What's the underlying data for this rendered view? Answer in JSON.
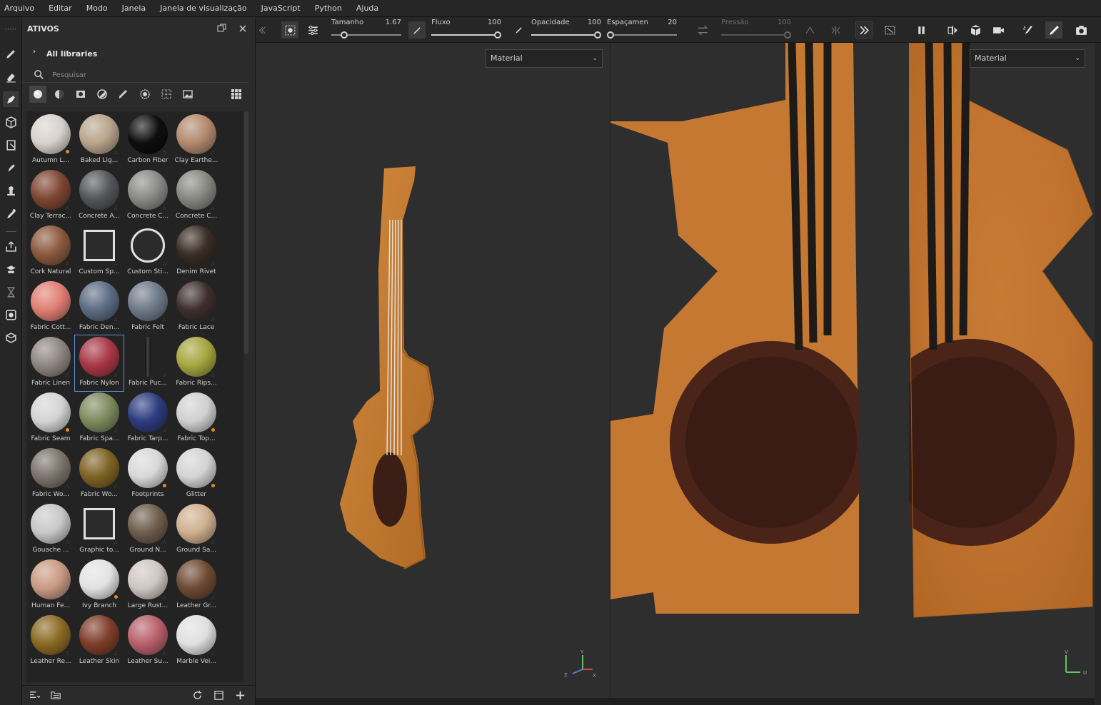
{
  "menu": [
    "Arquivo",
    "Editar",
    "Modo",
    "Janela",
    "Janela de visualização",
    "JavaScript",
    "Python",
    "Ajuda"
  ],
  "assets_panel": {
    "title": "ATIVOS",
    "library": "All libraries",
    "search_placeholder": "Pesquisar",
    "items": [
      {
        "label": "Autumn L...",
        "color": "#d8d2cc",
        "badge": "orange",
        "icon": "leaf-icon"
      },
      {
        "label": "Baked Lig...",
        "color": "#b9a48c"
      },
      {
        "label": "Carbon Fiber",
        "color": "#0e0e0e"
      },
      {
        "label": "Clay Earthe...",
        "color": "#b28a6e"
      },
      {
        "label": "Clay Terrac...",
        "color": "#7e4632"
      },
      {
        "label": "Concrete A...",
        "color": "#55565a"
      },
      {
        "label": "Concrete C...",
        "color": "#8a8a88"
      },
      {
        "label": "Concrete C...",
        "color": "#878782"
      },
      {
        "label": "Cork Natural",
        "color": "#8b5a3e"
      },
      {
        "label": "Custom Sp...",
        "color": "#2b2b2b",
        "icon": "spray-icon"
      },
      {
        "label": "Custom Sti...",
        "color": "#2b2b2b",
        "icon": "sticker-icon"
      },
      {
        "label": "Denim Rivet",
        "color": "#3a2e26"
      },
      {
        "label": "Fabric Cott...",
        "color": "#e07e72"
      },
      {
        "label": "Fabric Den...",
        "color": "#5d6c84"
      },
      {
        "label": "Fabric Felt",
        "color": "#6f7a88"
      },
      {
        "label": "Fabric Lace",
        "color": "#3e2f2f"
      },
      {
        "label": "Fabric Linen",
        "color": "#8f8580"
      },
      {
        "label": "Fabric Nylon",
        "color": "#a83846",
        "selected": true
      },
      {
        "label": "Fabric Puc...",
        "color": "#2b2b2b",
        "icon": "thin-strip"
      },
      {
        "label": "Fabric Rips...",
        "color": "#a4a63e"
      },
      {
        "label": "Fabric Seam",
        "color": "#d4d4d4",
        "badge": "orange"
      },
      {
        "label": "Fabric Spa...",
        "color": "#7e8a5e"
      },
      {
        "label": "Fabric Tarp...",
        "color": "#2d3c7e"
      },
      {
        "label": "Fabric Top...",
        "color": "#d0d0d0",
        "badge": "orange"
      },
      {
        "label": "Fabric Wo...",
        "color": "#7c746c"
      },
      {
        "label": "Fabric Wo...",
        "color": "#7e6224"
      },
      {
        "label": "Footprints",
        "color": "#d8d8d8",
        "badge": "orange"
      },
      {
        "label": "Glitter",
        "color": "#d4d4d4",
        "badge": "orange"
      },
      {
        "label": "Gouache ...",
        "color": "#c8c8c8"
      },
      {
        "label": "Graphic to...",
        "color": "#2b2b2b",
        "icon": "graphic-tool-icon"
      },
      {
        "label": "Ground N...",
        "color": "#6e5e4c"
      },
      {
        "label": "Ground Sa...",
        "color": "#cfb08e"
      },
      {
        "label": "Human Fe...",
        "color": "#c89a82",
        "icon": "face"
      },
      {
        "label": "Ivy Branch",
        "color": "#e2e2e2",
        "badge": "orange",
        "icon": "ivy"
      },
      {
        "label": "Large Rust...",
        "color": "#cfc6c2"
      },
      {
        "label": "Leather Gr...",
        "color": "#6e4a34"
      },
      {
        "label": "Leather Re...",
        "color": "#8a6a24"
      },
      {
        "label": "Leather Skin",
        "color": "#7e3e2a"
      },
      {
        "label": "Leather Su...",
        "color": "#b8606a"
      },
      {
        "label": "Marble Vei...",
        "color": "#e0e0e0"
      }
    ]
  },
  "toolbar": {
    "size_label": "Tamanho",
    "size_value": "1.67",
    "flow_label": "Fluxo",
    "flow_value": "100",
    "opacity_label": "Opacidade",
    "opacity_value": "100",
    "spacing_label": "Espaçamen",
    "spacing_value": "20",
    "pressure_label": "Pressão",
    "pressure_value": "100"
  },
  "viewport3d": {
    "channel": "Material",
    "axes": {
      "y": "Y",
      "x": "X",
      "z": "Z"
    }
  },
  "viewport2d": {
    "channel": "Material",
    "axes": {
      "v": "V",
      "u": "U"
    }
  }
}
